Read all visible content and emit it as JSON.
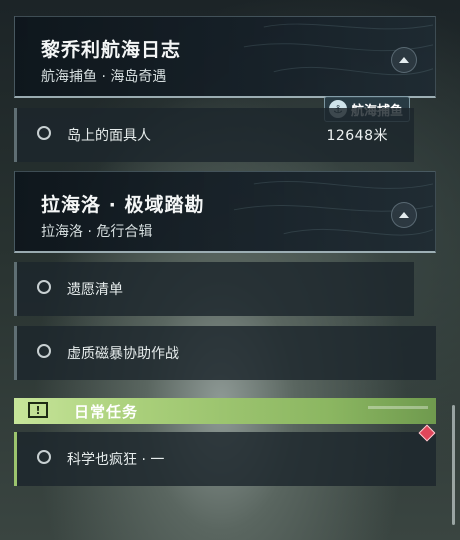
{
  "quests": [
    {
      "title": "黎乔利航海日志",
      "subtitle": "航海捕鱼 · 海岛奇遇",
      "task": {
        "label": "岛上的面具人",
        "distance": "12648米"
      },
      "badge": "航海捕鱼"
    },
    {
      "title": "拉海洛 · 极域踏勘",
      "subtitle": "拉海洛 · 危行合辑",
      "task": {
        "label": "遗愿清单"
      }
    }
  ],
  "standalone_task": {
    "label": "虚质磁暴协助作战"
  },
  "daily": {
    "icon": "!",
    "label": "日常任务",
    "task": {
      "label": "科学也疯狂 · 一"
    }
  },
  "icons": {
    "collapse": "chevron-up-icon",
    "badge": "anchor-icon",
    "daily": "exclamation-icon",
    "tracking": "diamond-icon"
  },
  "colors": {
    "daily_accent": "#a9cf7a",
    "tracking_marker": "#e0465a"
  }
}
